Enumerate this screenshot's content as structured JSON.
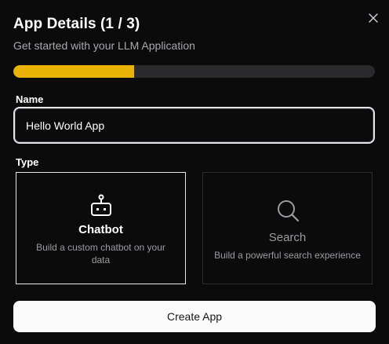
{
  "dialog": {
    "title": "App Details (1 / 3)",
    "subtitle": "Get started with your LLM Application",
    "close_icon": "close-icon",
    "progress": {
      "step": 1,
      "total": 3,
      "fraction": 0.333,
      "fill_color": "#eab308",
      "track_color": "#2a2a2d"
    }
  },
  "name_field": {
    "label": "Name",
    "value": "Hello World App"
  },
  "type_section": {
    "label": "Type",
    "options": [
      {
        "id": "chatbot",
        "icon": "robot-icon",
        "title": "Chatbot",
        "description": "Build a custom chatbot on your data",
        "selected": true
      },
      {
        "id": "search",
        "icon": "search-icon",
        "title": "Search",
        "description": "Build a powerful search experience",
        "selected": false
      }
    ]
  },
  "footer": {
    "create_label": "Create App"
  }
}
